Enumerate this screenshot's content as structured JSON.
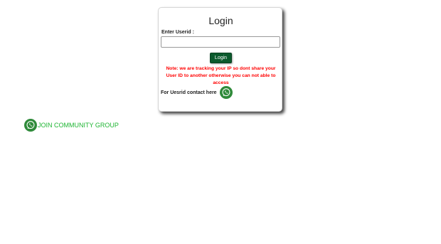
{
  "login": {
    "title": "Login",
    "userid_label": "Enter Userid :",
    "userid_value": "",
    "userid_placeholder": "",
    "submit_label": "Login",
    "note": "Note: we are tracking your IP so dont share your User ID to another otherwise you can not able to access",
    "contact_label": "For Uesrid contact here"
  },
  "community": {
    "join_label": "JOIN COMMUNITY GROUP"
  },
  "colors": {
    "button_bg": "#0b5a2d",
    "note_text": "#ff0000",
    "join_text": "#1fb533",
    "whatsapp_bg": "#2f8a3a"
  },
  "icons": {
    "contact": "whatsapp-icon",
    "join": "whatsapp-icon"
  }
}
